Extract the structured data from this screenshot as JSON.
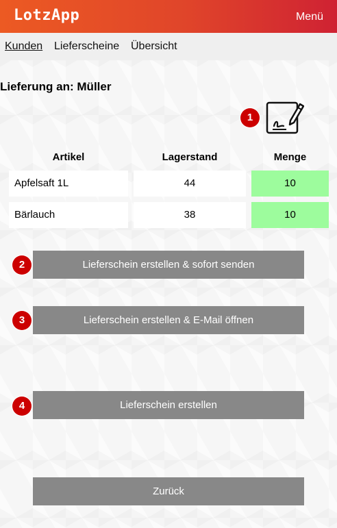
{
  "app": {
    "title": "LotzApp",
    "menu_label": "Menü"
  },
  "nav": {
    "items": [
      "Kunden",
      "Lieferscheine",
      "Übersicht"
    ]
  },
  "page": {
    "title": "Lieferung an: Müller"
  },
  "badges": [
    "1",
    "2",
    "3",
    "4"
  ],
  "table": {
    "headers": [
      "Artikel",
      "Lagerstand",
      "Menge"
    ],
    "rows": [
      {
        "article": "Apfelsaft 1L",
        "stock": "44",
        "quantity": "10"
      },
      {
        "article": "Bärlauch",
        "stock": "38",
        "quantity": "10"
      }
    ]
  },
  "buttons": {
    "create_send": "Lieferschein erstellen & sofort senden",
    "create_email": "Lieferschein erstellen & E-Mail öffnen",
    "create": "Lieferschein erstellen",
    "back": "Zurück"
  },
  "icons": {
    "signature": "signature-pen-icon"
  },
  "colors": {
    "header_start": "#ec5a23",
    "header_end": "#cf2233",
    "badge": "#cc0000",
    "button": "#888888",
    "quantity_bg": "#9dfc9d"
  }
}
